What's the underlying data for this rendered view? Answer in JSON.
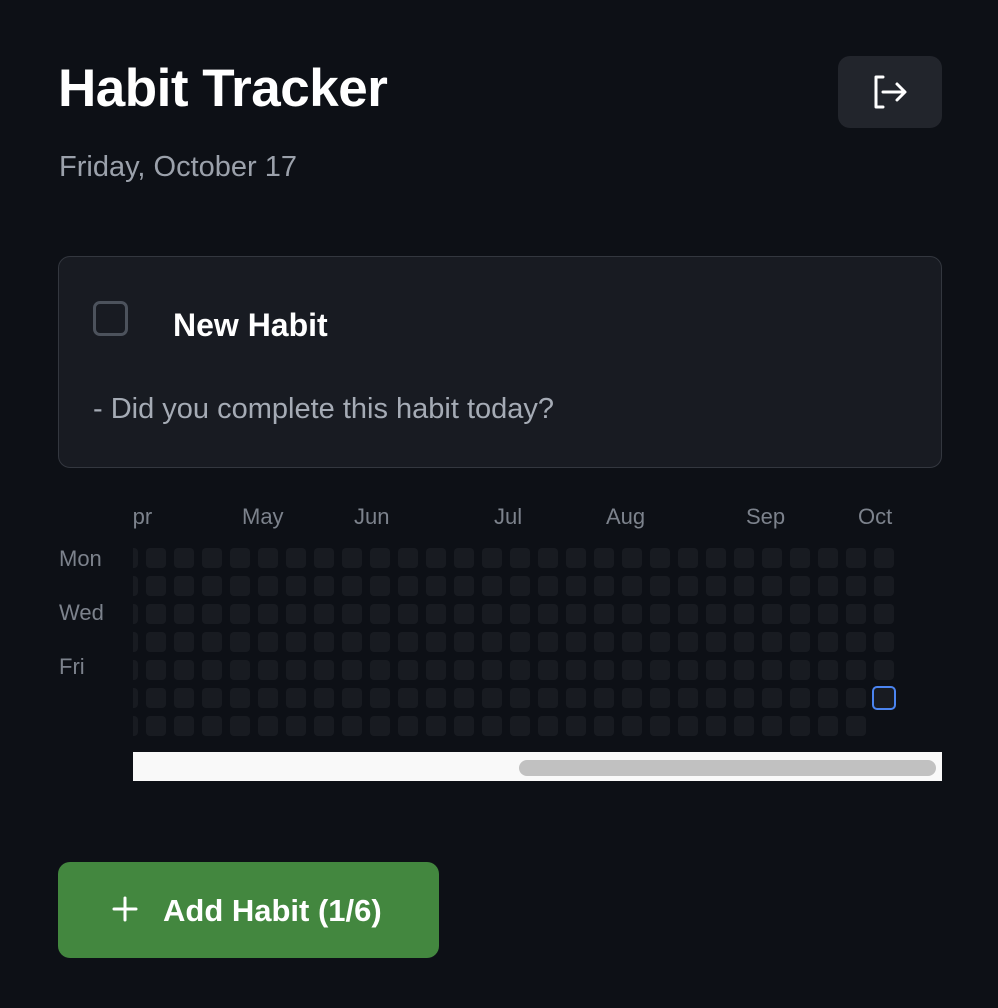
{
  "header": {
    "title": "Habit Tracker",
    "date": "Friday, October 17",
    "logout_icon": "logout-icon"
  },
  "habit": {
    "name": "New Habit",
    "question": "- Did you complete this habit today?",
    "completed_today": false
  },
  "heatmap": {
    "months": [
      "Apr",
      "May",
      "Jun",
      "Jul",
      "Aug",
      "Sep",
      "Oct"
    ],
    "day_labels": [
      "Mon",
      "Wed",
      "Fri"
    ],
    "weeks_visible": 28,
    "last_week_days": 6,
    "today_marker_color": "#4b84f0"
  },
  "add_button": {
    "label": "Add Habit (1/6)",
    "icon": "plus-icon"
  }
}
